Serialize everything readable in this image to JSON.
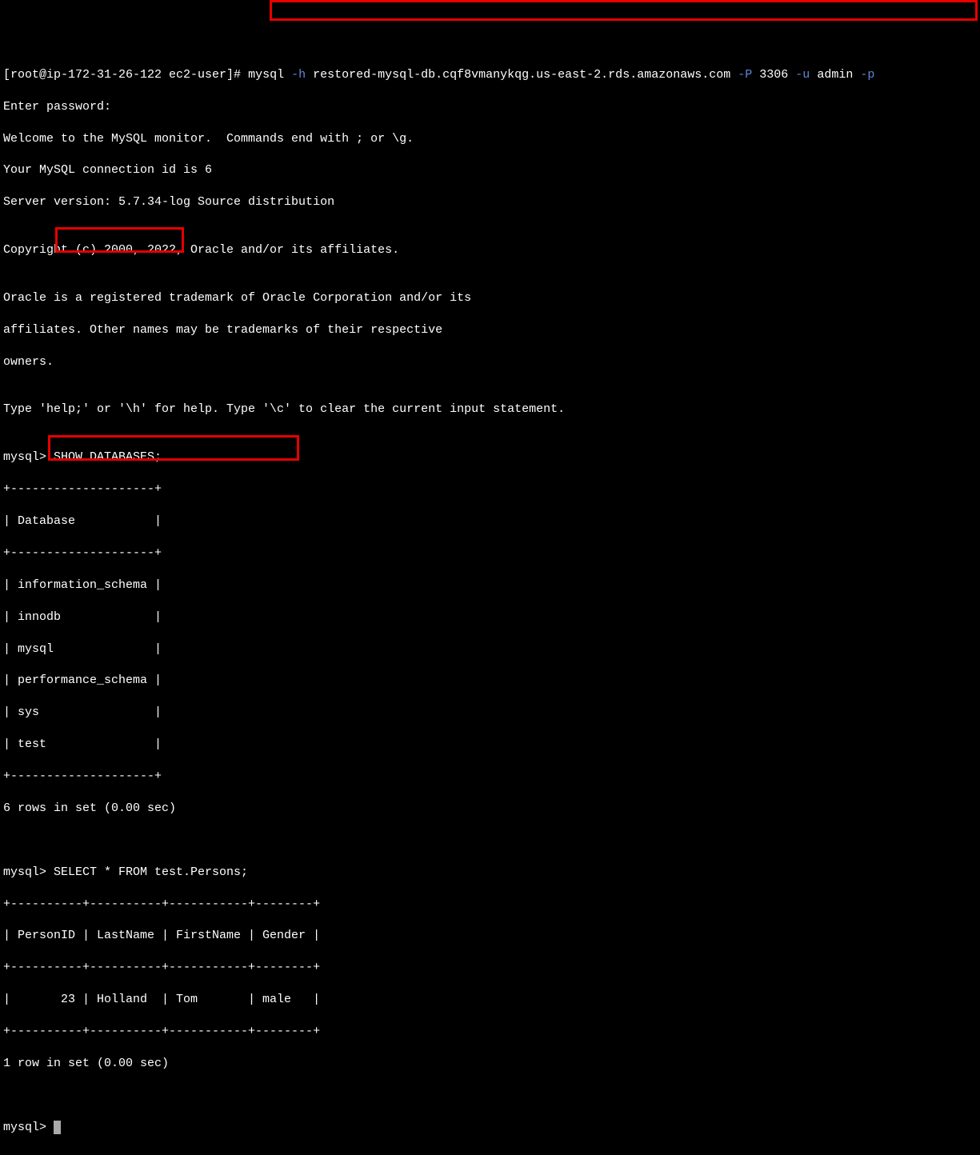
{
  "shell_prompt": "[root@ip-172-31-26-122 ec2-user]# ",
  "mysql_cmd": {
    "bin": "mysql",
    "flag_h": "-h",
    "host": "restored-mysql-db.cqf8vmanykqg.us-east-2.rds.amazonaws.com",
    "flag_P": "-P",
    "port": "3306",
    "flag_u": "-u",
    "user": "admin",
    "flag_p": "-p"
  },
  "banner": [
    "Enter password:",
    "Welcome to the MySQL monitor.  Commands end with ; or \\g.",
    "Your MySQL connection id is 6",
    "Server version: 5.7.34-log Source distribution",
    "",
    "Copyright (c) 2000, 2022, Oracle and/or its affiliates.",
    "",
    "Oracle is a registered trademark of Oracle Corporation and/or its",
    "affiliates. Other names may be trademarks of their respective",
    "owners.",
    "",
    "Type 'help;' or '\\h' for help. Type '\\c' to clear the current input statement.",
    ""
  ],
  "mysql_prompt": "mysql> ",
  "query1": "SHOW DATABASES;",
  "db_table": {
    "border_top": "+--------------------+",
    "header": "| Database           |",
    "rows": [
      "| information_schema |",
      "| innodb             |",
      "| mysql              |",
      "| performance_schema |",
      "| sys                |",
      "| test               |"
    ],
    "footer": "6 rows in set (0.00 sec)"
  },
  "query2": "SELECT * FROM test.Persons;",
  "persons_table": {
    "border": "+----------+----------+-----------+--------+",
    "header": "| PersonID | LastName | FirstName | Gender |",
    "rows": [
      "|       23 | Holland  | Tom       | male   |"
    ],
    "footer": "1 row in set (0.00 sec)"
  }
}
